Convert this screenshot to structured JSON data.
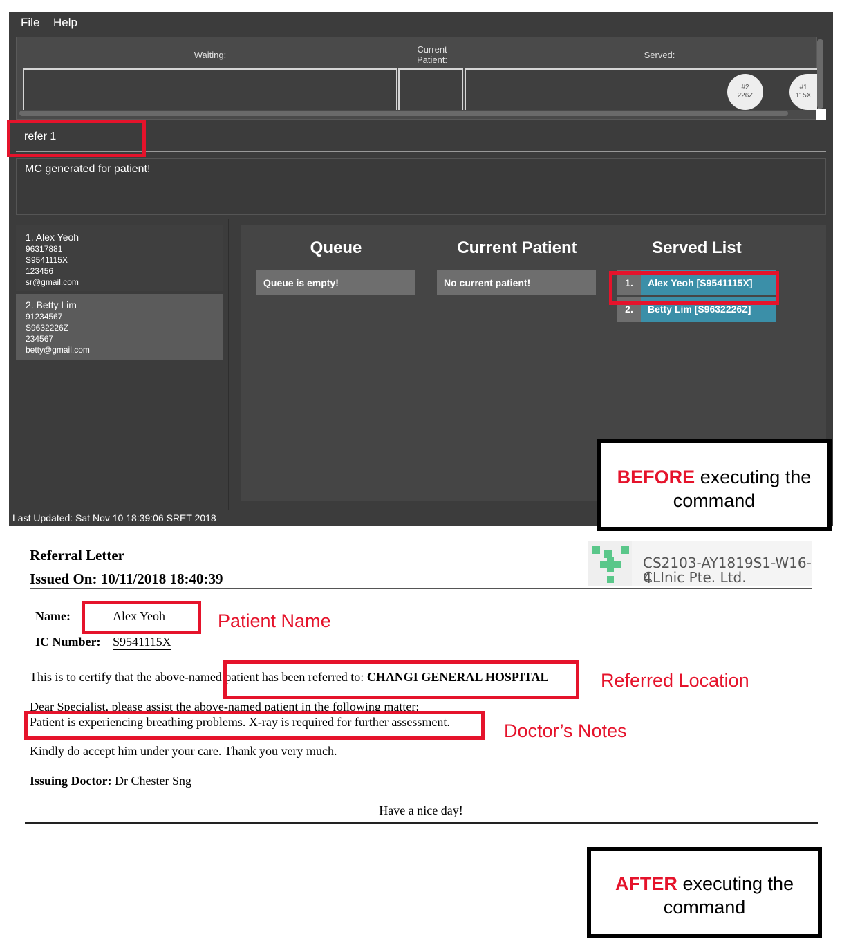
{
  "menu": {
    "file": "File",
    "help": "Help"
  },
  "queue_panel": {
    "waiting_label": "Waiting:",
    "current_label_line1": "Current",
    "current_label_line2": "Patient:",
    "served_label": "Served:",
    "served_tokens": [
      {
        "num": "#2",
        "code": "226Z"
      },
      {
        "num": "#1",
        "code": "115X"
      }
    ]
  },
  "command": {
    "value": "refer 1"
  },
  "result": {
    "text": "MC generated for patient!"
  },
  "persons": [
    {
      "name": "1.  Alex Yeoh",
      "phone": "96317881",
      "ic": "S9541115X",
      "address": "123456",
      "email": "sr@gmail.com"
    },
    {
      "name": "2.  Betty Lim",
      "phone": "91234567",
      "ic": "S9632226Z",
      "address": "234567",
      "email": "betty@gmail.com"
    }
  ],
  "main": {
    "queue_title": "Queue",
    "queue_empty": "Queue is empty!",
    "current_title": "Current Patient",
    "current_empty": "No current patient!",
    "served_title": "Served List",
    "served_rows": [
      {
        "num": "1.",
        "name": "Alex Yeoh [S9541115X]"
      },
      {
        "num": "2.",
        "name": "Betty Lim [S9632226Z]"
      }
    ]
  },
  "status": {
    "last_updated": "Last Updated: Sat Nov 10 18:39:06 SRET 2018"
  },
  "notes": {
    "before_hl": "BEFORE",
    "before_rest": " executing the",
    "before_line2": "command",
    "after_hl": "AFTER",
    "after_rest": " executing the",
    "after_line2": "command"
  },
  "annotations": {
    "patient_name": "Patient Name",
    "referred_location": "Referred Location",
    "doctors_notes": "Doctor’s Notes"
  },
  "letter": {
    "title": "Referral Letter",
    "issued": "Issued On: 10/11/2018 18:40:39",
    "clinic_line1": "CS2103-AY1819S1-W16-4",
    "clinic_line2": "CLInic Pte. Ltd.",
    "name_label": "Name:",
    "name_value": "Alex Yeoh",
    "ic_label": "IC Number:",
    "ic_value": "S9541115X",
    "certify_text": "This is to certify that the above-named patient has been referred to: ",
    "certify_location": "CHANGI GENERAL HOSPITAL",
    "dear_text": "Dear Specialist, please assist the above-named patient in the following matter:",
    "notes_text": "Patient is experiencing breathing problems. X-ray is required for further assessment.",
    "kindly_text": "Kindly do accept him under your care. Thank you very much.",
    "doctor_label": "Issuing Doctor:",
    "doctor_value": " Dr Chester Sng",
    "closing": "Have a nice day!"
  },
  "colors": {
    "accent_red": "#e5132b",
    "served_teal": "#3b8fa8",
    "app_bg": "#3c3c3c"
  }
}
